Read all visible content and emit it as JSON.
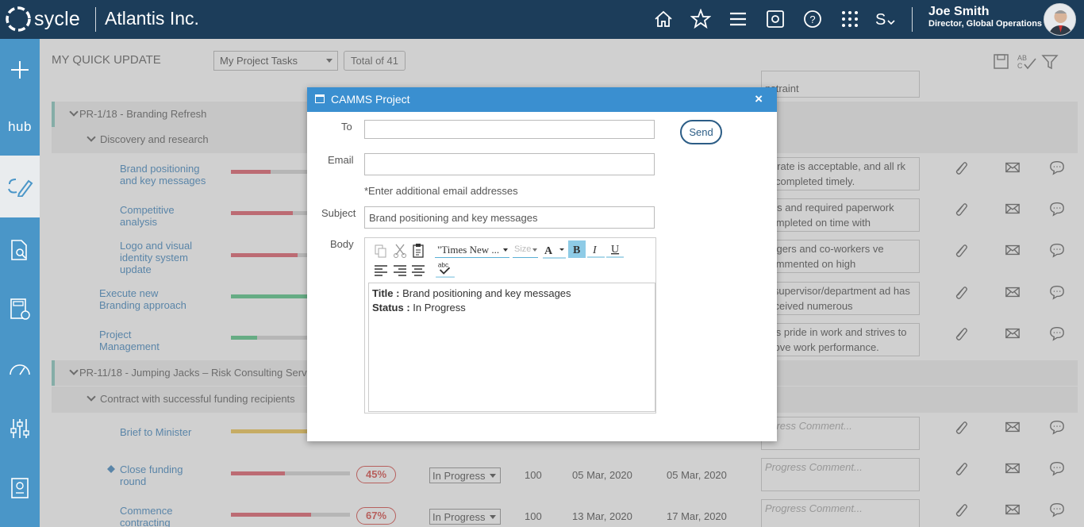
{
  "header": {
    "logo_text": "sycle",
    "organization": "Atlantis Inc.",
    "user_name": "Joe Smith",
    "user_role": "Director, Global Operations",
    "nav_icons": [
      "home-icon",
      "star-icon",
      "menu-icon",
      "report-icon",
      "help-icon",
      "apps-grid-icon",
      "settings-icon"
    ]
  },
  "sidebar": {
    "items": [
      "plus-icon",
      "hub",
      "update-icon",
      "search-doc-icon",
      "calculator-icon",
      "gauge-icon",
      "sliders-icon",
      "report-icon"
    ],
    "hub_label": "hub"
  },
  "main": {
    "title": "MY QUICK UPDATE",
    "project_filter": "My Project Tasks",
    "total": "Total of 41",
    "rows": {
      "partial": {
        "comment": "nstraint"
      },
      "group1": "PR-1/18 - Branding Refresh",
      "subgroup1": "Discovery and research",
      "tasks": [
        {
          "name": "Brand positioning and key messages",
          "progress": 0.33,
          "color": "#e06470",
          "comment": "or rate is acceptable, and all rk is completed timely."
        },
        {
          "name": "Competitive analysis",
          "progress": 0.52,
          "color": "#e06470",
          "comment": "rms and required paperwork completed on time with"
        },
        {
          "name": "Logo and visual identity system update",
          "progress": 0.56,
          "color": "#e06470",
          "comment": "nagers and co-workers ve commented on high"
        },
        {
          "name": "Execute new Branding approach",
          "progress": 0.64,
          "color": "#5cc88a",
          "comment": "e supervisor/department ad has received numerous"
        },
        {
          "name": "Project Management",
          "progress": 0.22,
          "color": "#5cc88a",
          "comment": "kes pride in work and strives to prove work performance."
        }
      ],
      "group2": "PR-11/18 - Jumping Jacks – Risk Consulting Serv",
      "subgroup2": "Contract with successful funding recipients",
      "tasks2": [
        {
          "name": "Brief to Minister",
          "progress": 0.64,
          "color": "#f0c85a",
          "comment": "ogress Comment..."
        },
        {
          "name": "Close funding round",
          "progress": 0.45,
          "color": "#e06470",
          "pct": "45%",
          "status": "In Progress",
          "weight": "100",
          "start": "05 Mar, 2020",
          "end": "05 Mar, 2020",
          "comment": "Progress Comment..."
        },
        {
          "name": "Commence contracting",
          "progress": 0.67,
          "color": "#e06470",
          "pct": "67%",
          "status": "In Progress",
          "weight": "100",
          "start": "13 Mar, 2020",
          "end": "17 Mar, 2020",
          "comment": "Progress Comment..."
        }
      ]
    }
  },
  "modal": {
    "title": "CAMMS Project",
    "close": "×",
    "to_label": "To",
    "to_value": "",
    "send_label": "Send",
    "email_label": "Email",
    "email_value": "",
    "email_hint": "*Enter additional email addresses",
    "subject_label": "Subject",
    "subject_value": "Brand positioning and key messages",
    "body_label": "Body",
    "editor": {
      "font": "\"Times New ...",
      "size": "Size",
      "body_title_label": "Title :",
      "body_title_value": "Brand positioning and key messages",
      "body_status_label": "Status :",
      "body_status_value": "In Progress"
    }
  }
}
